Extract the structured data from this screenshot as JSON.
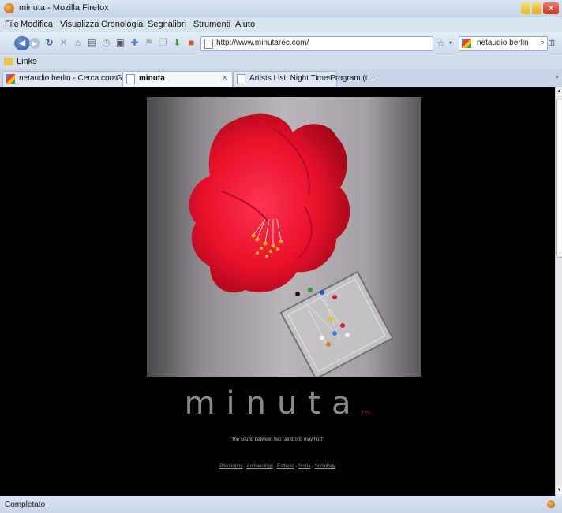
{
  "window": {
    "title": "minuta - Mozilla Firefox"
  },
  "menu": [
    "File",
    "Modifica",
    "Visualizza",
    "Cronologia",
    "Segnalibri",
    "Strumenti",
    "Aiuto"
  ],
  "address_bar": {
    "url": "http://www.minutarec.com/"
  },
  "search_bar": {
    "engine_icon": "google-icon",
    "value": "netaudio berlin"
  },
  "bookmarks_bar": {
    "folder_label": "Links"
  },
  "tabs": [
    {
      "label": "netaudio berlin - Cerca con Google",
      "active": false
    },
    {
      "label": "minuta",
      "active": true
    },
    {
      "label": "Artists List: Night Time Program (t...",
      "active": false
    }
  ],
  "page": {
    "logo_text": "minuta",
    "logo_sub": "rec",
    "tagline": "\"the sound between two raindrops may hurt\"",
    "nav_links": [
      "Philosophy",
      "Archaeology",
      "Esthetic",
      "Storia",
      "Sociology"
    ],
    "nav_separator": " - "
  },
  "status_bar": {
    "text": "Completato"
  },
  "colors": {
    "page_background": "#000000",
    "flower": "#e8102a",
    "logo": "#8a8a8a"
  }
}
